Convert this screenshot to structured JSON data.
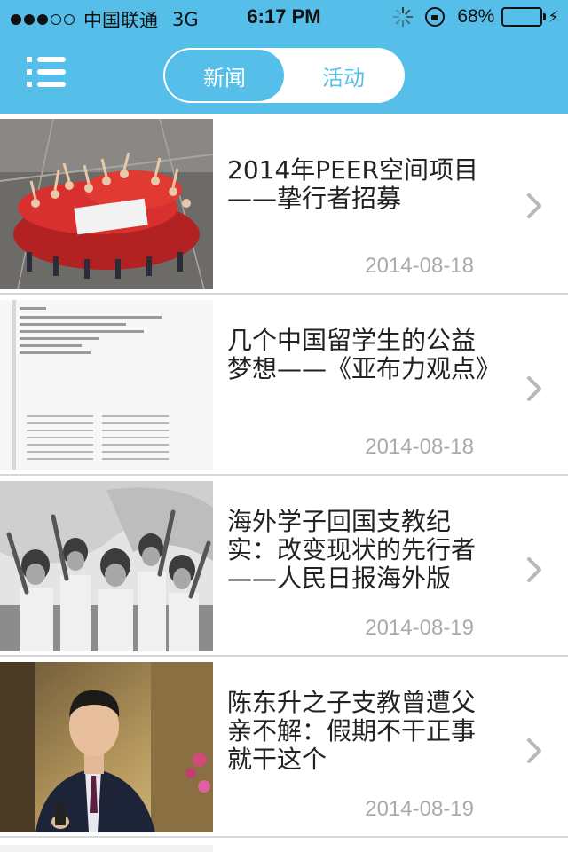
{
  "status_bar": {
    "carrier": "中国联通",
    "network": "3G",
    "time": "6:17 PM",
    "battery_percent": "68%",
    "battery_level": 0.68
  },
  "nav": {
    "tabs": [
      {
        "label": "新闻",
        "active": true
      },
      {
        "label": "活动",
        "active": false
      }
    ]
  },
  "news": [
    {
      "title": "2014年PEER空间项目——挚行者招募",
      "date": "2014-08-18"
    },
    {
      "title": "几个中国留学生的公益梦想——《亚布力观点》",
      "date": "2014-08-18"
    },
    {
      "title": "海外学子回国支教纪实：改变现状的先行者——人民日报海外版",
      "date": "2014-08-19"
    },
    {
      "title": "陈东升之子支教曾遭父亲不解：假期不干正事就干这个",
      "date": "2014-08-19"
    }
  ],
  "icons": {
    "menu": "menu-icon",
    "chevron": "chevron-right-icon"
  },
  "colors": {
    "accent": "#55bfe9",
    "date_text": "#aaaaaa",
    "divider": "#d8d8d8"
  }
}
